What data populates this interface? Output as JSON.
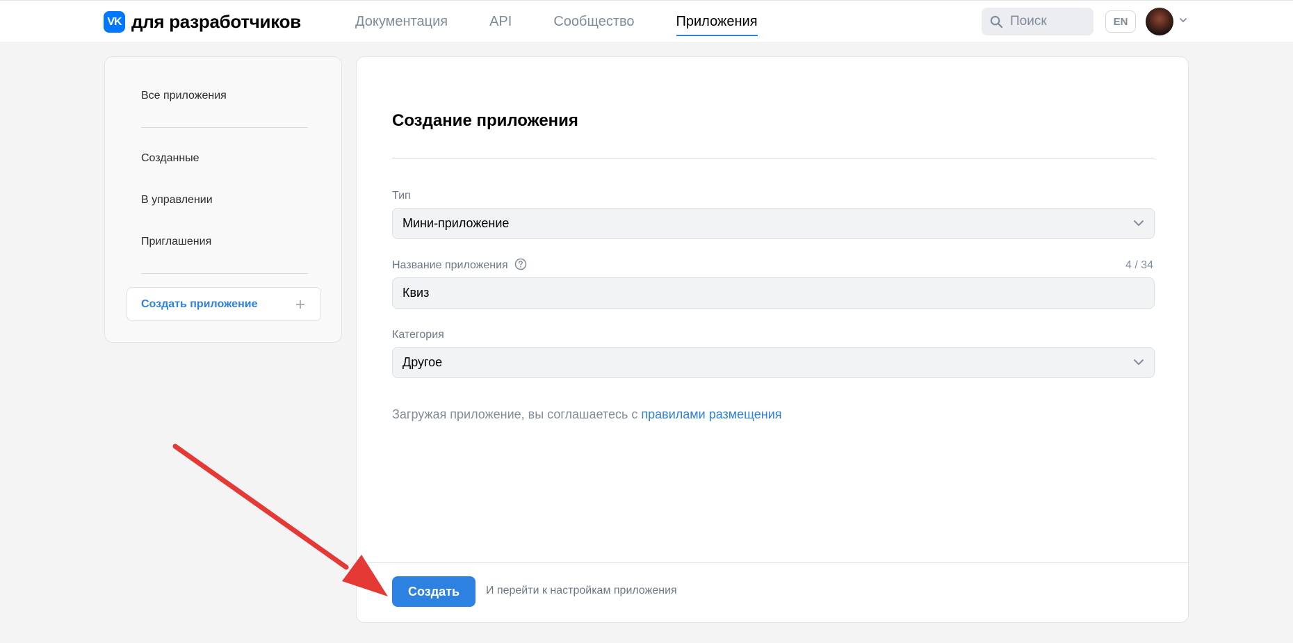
{
  "header": {
    "logo_mark": "VK",
    "logo_text": "для разработчиков",
    "nav": [
      {
        "label": "Документация",
        "active": false
      },
      {
        "label": "API",
        "active": false
      },
      {
        "label": "Сообщество",
        "active": false
      },
      {
        "label": "Приложения",
        "active": true
      }
    ],
    "search_placeholder": "Поиск",
    "lang_button": "EN",
    "icons": {
      "search": "search-icon",
      "chevron": "chevron-down-icon",
      "avatar": "user-avatar"
    }
  },
  "sidebar": {
    "items": [
      {
        "label": "Все приложения"
      },
      {
        "label": "Созданные"
      },
      {
        "label": "В управлении"
      },
      {
        "label": "Приглашения"
      }
    ],
    "create_button": "Создать приложение"
  },
  "form": {
    "title": "Создание приложения",
    "type": {
      "label": "Тип",
      "value": "Мини-приложение"
    },
    "name": {
      "label": "Название приложения",
      "value": "Квиз",
      "counter": "4 / 34"
    },
    "category": {
      "label": "Категория",
      "value": "Другое"
    },
    "notice_text": "Загружая приложение, вы соглашаетесь с",
    "notice_link": "правилами размещения",
    "submit_label": "Создать",
    "submit_note": "И перейти к настройкам приложения"
  },
  "colors": {
    "accent": "#2d81e0",
    "vk_blue": "#0077ff",
    "annotation_arrow": "#e53935"
  }
}
